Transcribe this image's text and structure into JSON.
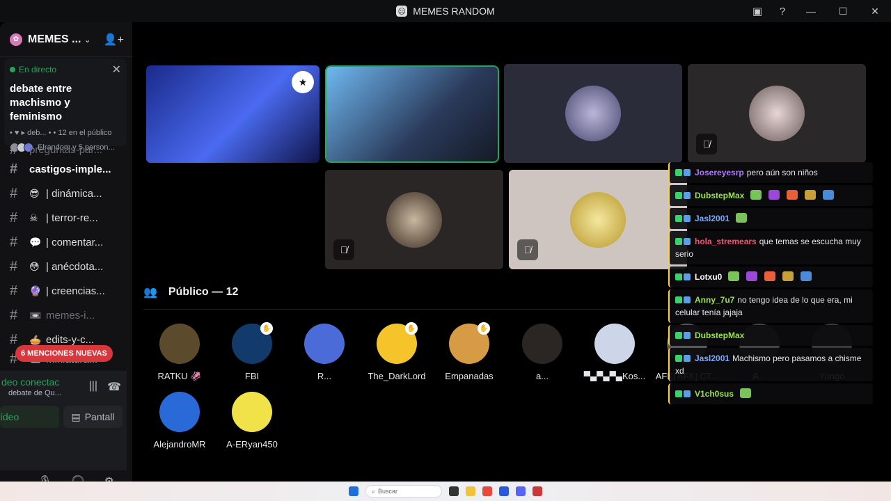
{
  "window": {
    "title": "MEMES RANDOM"
  },
  "sidebar": {
    "server_name": "MEMES ...",
    "live": {
      "status": "En directo",
      "title": "debate entre machismo y feminismo",
      "meta": "• ♥ ▸ deb... • • 12 en el público",
      "people": "Elrandom y 5 person..."
    },
    "channels": [
      {
        "emoji": "",
        "label": "preguntas-par...",
        "style": "muted"
      },
      {
        "emoji": "",
        "label": "castigos-imple...",
        "style": "bold"
      },
      {
        "emoji": "😎",
        "label": "| dinámica...",
        "style": "normal"
      },
      {
        "emoji": "☠",
        "label": "| terror-re...",
        "style": "normal"
      },
      {
        "emoji": "💬",
        "label": "| comentar...",
        "style": "normal"
      },
      {
        "emoji": "😳",
        "label": "| anécdota...",
        "style": "normal"
      },
      {
        "emoji": "🔮",
        "label": "| creencias...",
        "style": "normal"
      },
      {
        "emoji": "📼",
        "label": "memes-i...",
        "style": "muted"
      },
      {
        "emoji": "🥧",
        "label": "edits-y-c...",
        "style": "normal"
      },
      {
        "emoji": "🎞",
        "label": "miniatura...",
        "style": "normal"
      }
    ],
    "mentions": "6 MENCIONES NUEVAS",
    "voice": {
      "status": "deo conectac",
      "channel": "debate de Qu...",
      "video_label": "ídeo",
      "screen_label": "Pantall"
    }
  },
  "stage": {
    "audience_title": "Público — 12",
    "audience": [
      {
        "name": "RATKU 🦑",
        "color": "#5b4a2c",
        "hand": false
      },
      {
        "name": "FBI",
        "color": "#123a6b",
        "hand": true
      },
      {
        "name": "R...",
        "color": "#4a6bd8",
        "hand": false
      },
      {
        "name": "The_DarkLord",
        "color": "#f5c42a",
        "hand": true
      },
      {
        "name": "Empanadas",
        "color": "#d79a45",
        "hand": true
      },
      {
        "name": "a...",
        "color": "#2b2523",
        "hand": false
      },
      {
        "name": "▀▄▀▄▀▄Kos...",
        "color": "#cdd6e8",
        "hand": false
      },
      {
        "name": "AFK| AFK| CT...",
        "color": "#5a5a5a",
        "hand": false
      },
      {
        "name": "A...",
        "color": "#444",
        "hand": false
      },
      {
        "name": "Yungo",
        "color": "#3a3a3a",
        "hand": false
      },
      {
        "name": "AlejandroMR",
        "color": "#2a6ad8",
        "hand": false
      },
      {
        "name": "A-ERyan450",
        "color": "#f1e24a",
        "hand": false
      }
    ]
  },
  "chat": [
    {
      "user": "Josereyesrp",
      "color": "#b07aff",
      "text": "pero aún son niños"
    },
    {
      "user": "DubstepMax",
      "color": "#9be34a",
      "text": "",
      "emotes": 5
    },
    {
      "user": "Jasl2001",
      "color": "#7aa9ff",
      "text": "",
      "emotes": 1
    },
    {
      "user": "hola_stremears",
      "color": "#ff4d6d",
      "text": "que temas se escucha muy serio"
    },
    {
      "user": "Lotxu0",
      "color": "#ffffff",
      "text": "",
      "emotes": 5
    },
    {
      "user": "Anny_7u7",
      "color": "#9be34a",
      "text": "no tengo idea de lo que era, mi celular tenía jajaja"
    },
    {
      "user": "DubstepMax",
      "color": "#9be34a",
      "text": ""
    },
    {
      "user": "Jasl2001",
      "color": "#7aa9ff",
      "text": "Machismo pero pasamos a chisme xd"
    },
    {
      "user": "V1ch0sus",
      "color": "#9be34a",
      "text": "",
      "emotes": 1
    }
  ],
  "taskbar": {
    "search": "Buscar"
  }
}
